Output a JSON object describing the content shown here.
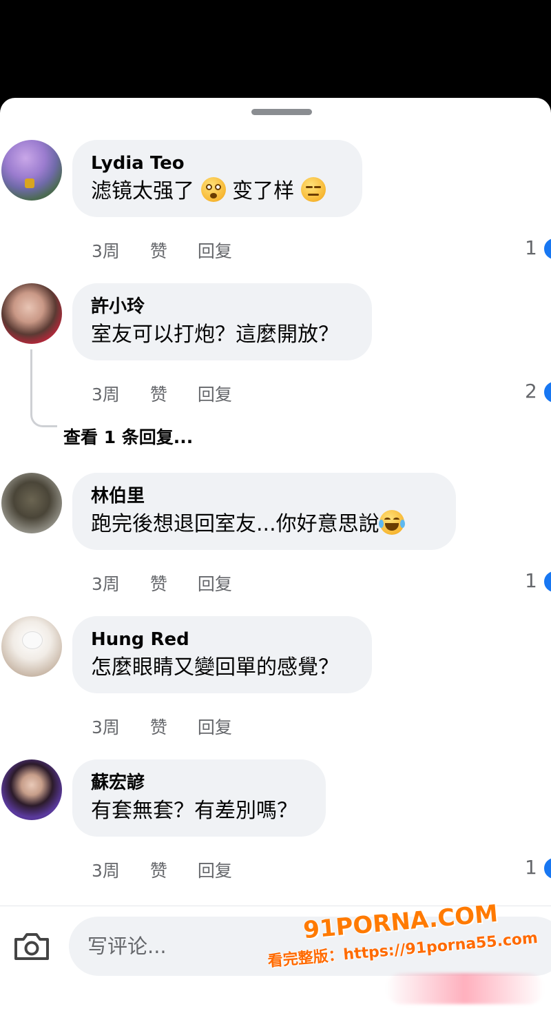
{
  "comments": [
    {
      "name": "Lydia Teo",
      "text_parts": [
        "滤镜太强了",
        "变了样"
      ],
      "emojis": [
        "flushed-face-emoji",
        "expressionless-face-emoji"
      ],
      "time": "3周",
      "like": "赞",
      "reply": "回复",
      "reactions": "1",
      "avatar": "cherry-blossom-avatar"
    },
    {
      "name": "許小玲",
      "text": "室友可以打炮？這麼開放？",
      "time": "3周",
      "like": "赞",
      "reply": "回复",
      "reactions": "2",
      "avatar": "woman-red-dress-avatar",
      "view_replies": "查看 1 条回复..."
    },
    {
      "name": "林伯里",
      "text": "跑完後想退回室友...你好意思說",
      "emoji": "tears-of-joy-emoji",
      "time": "3周",
      "like": "赞",
      "reply": "回复",
      "reactions": "1",
      "avatar": "statue-avatar"
    },
    {
      "name": "Hung Red",
      "text": "怎麼眼睛又變回單的感覺？",
      "time": "3周",
      "like": "赞",
      "reply": "回复",
      "reactions": "",
      "avatar": "plush-toys-avatar"
    },
    {
      "name": "蘇宏諺",
      "text": "有套無套？有差別嗎？",
      "time": "3周",
      "like": "赞",
      "reply": "回复",
      "reactions": "1",
      "avatar": "woman-purple-avatar"
    }
  ],
  "composer": {
    "placeholder": "写评论...",
    "camera_icon": "camera-icon"
  },
  "watermark": {
    "line1": "91PORNA.COM",
    "line2": "看完整版：https://91porna55.com"
  },
  "colors": {
    "background_top": "#000000",
    "bubble": "#f0f2f5",
    "secondary_text": "#65676b",
    "reaction_blue": "#1877f2",
    "watermark_orange": "#ff7a00"
  }
}
